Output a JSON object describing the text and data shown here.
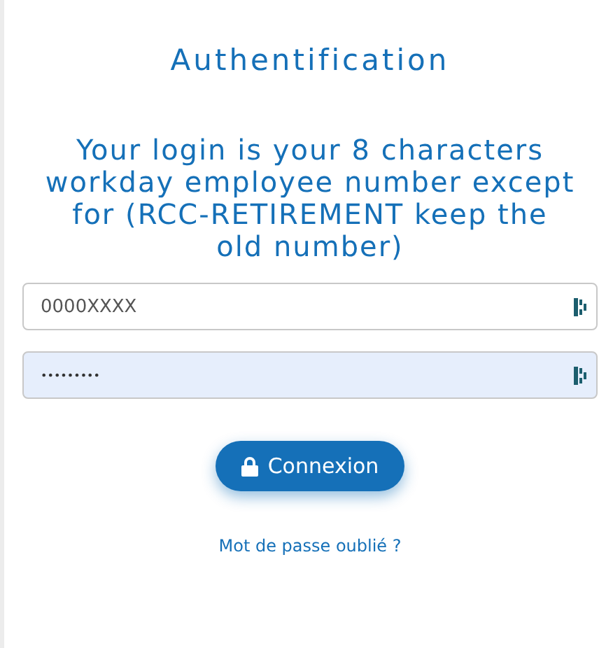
{
  "title": "Authentification",
  "instructions": "Your login is your 8 characters workday employee number except for (RCC-RETIREMENT keep the old number)",
  "fields": [
    {
      "kind": "login",
      "placeholder": "0000XXXX"
    },
    {
      "kind": "password",
      "value": "•••••••••"
    }
  ],
  "submit_button": "Connexion",
  "forgot_link": "Mot de passe oublié ?"
}
